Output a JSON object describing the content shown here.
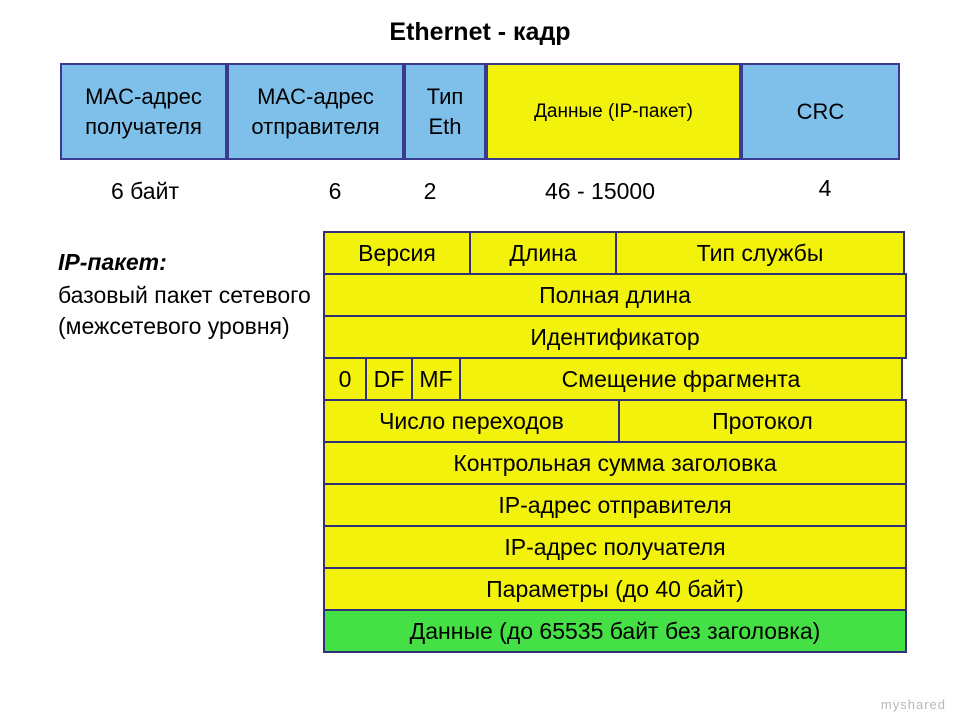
{
  "title": "Ethernet - кадр",
  "ethernet_frame": {
    "cells": [
      {
        "lines": [
          "MAC-адрес",
          "получателя"
        ],
        "color": "#7fc0eb",
        "size": "6 байт"
      },
      {
        "lines": [
          "MAC-адрес",
          "отправителя"
        ],
        "color": "#7fc0eb",
        "size": "6"
      },
      {
        "lines": [
          "Тип",
          "Eth"
        ],
        "color": "#7fc0eb",
        "size": "2"
      },
      {
        "lines": [
          "Данные (IP-пакет)"
        ],
        "color": "#f2f20d",
        "size": "46 - 15000"
      },
      {
        "lines": [
          "CRC"
        ],
        "color": "#7fc0eb",
        "size": "4"
      }
    ]
  },
  "caption": {
    "title": "IP-пакет:",
    "body": "базовый пакет сетевого (межсетевого уровня)"
  },
  "ip_packet": {
    "rows": [
      {
        "cells": [
          {
            "label": "Версия"
          },
          {
            "label": "Длина"
          },
          {
            "label": "Тип службы"
          }
        ]
      },
      {
        "cells": [
          {
            "label": "Полная длина"
          }
        ]
      },
      {
        "cells": [
          {
            "label": "Идентификатор"
          }
        ]
      },
      {
        "cells": [
          {
            "label": "0"
          },
          {
            "label": "DF"
          },
          {
            "label": "MF"
          },
          {
            "label": "Смещение фрагмента"
          }
        ]
      },
      {
        "cells": [
          {
            "label": "Число переходов"
          },
          {
            "label": "Протокол"
          }
        ]
      },
      {
        "cells": [
          {
            "label": "Контрольная сумма заголовка"
          }
        ]
      },
      {
        "cells": [
          {
            "label": "IP-адрес отправителя"
          }
        ]
      },
      {
        "cells": [
          {
            "label": "IP-адрес получателя"
          }
        ]
      },
      {
        "cells": [
          {
            "label": "Параметры (до 40 байт)"
          }
        ]
      },
      {
        "cells": [
          {
            "label": "Данные (до 65535 байт без заголовка)",
            "color": "#45e045"
          }
        ]
      }
    ]
  },
  "watermark": "myshared"
}
